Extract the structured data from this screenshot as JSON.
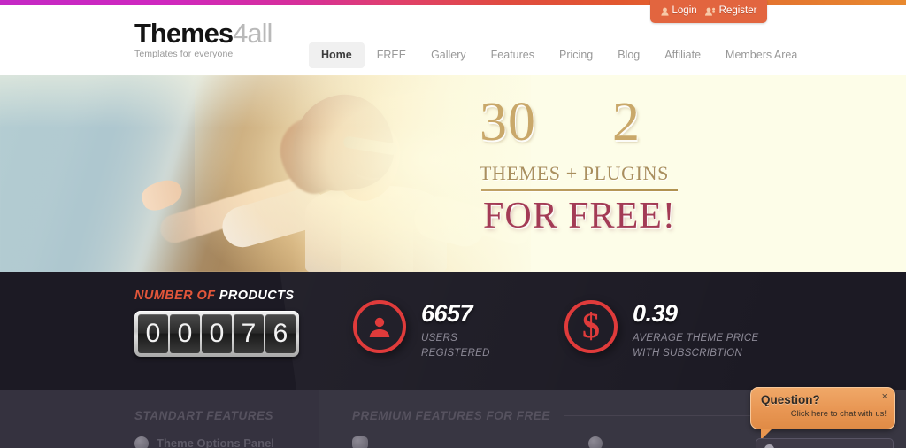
{
  "topbar": {
    "gradient_from": "#c429c4",
    "gradient_to": "#e8892f"
  },
  "auth": {
    "login_label": "Login",
    "register_label": "Register",
    "bg_color": "#e2653f"
  },
  "logo": {
    "part1": "Themes",
    "part2": "4all",
    "tagline": "Templates for everyone"
  },
  "nav": {
    "items": [
      {
        "label": "Home",
        "active": true
      },
      {
        "label": "FREE",
        "active": false
      },
      {
        "label": "Gallery",
        "active": false
      },
      {
        "label": "Features",
        "active": false
      },
      {
        "label": "Pricing",
        "active": false
      },
      {
        "label": "Blog",
        "active": false
      },
      {
        "label": "Affiliate",
        "active": false
      },
      {
        "label": "Members Area",
        "active": false
      }
    ]
  },
  "hero": {
    "themes_count": "30",
    "plugins_count": "2",
    "subtitle": "THEMES + PLUGINS",
    "headline": "FOR FREE!",
    "number_color": "#c9a86a",
    "headline_color": "#a33b55",
    "bg_color": "#fdfde8"
  },
  "stats": {
    "bg_color": "#1c1a24",
    "counter": {
      "label_orange": "NUMBER OF",
      "label_white": "PRODUCTS",
      "digits": [
        "0",
        "0",
        "0",
        "7",
        "6"
      ],
      "value": "00076"
    },
    "blocks": [
      {
        "icon": "user-icon",
        "number": "6657",
        "caption_line1": "USERS",
        "caption_line2": "REGISTERED"
      },
      {
        "icon": "dollar-icon",
        "number": "0.39",
        "caption_line1": "AVERAGE THEME PRICE",
        "caption_line2": "WITH SUBSCRIBTION"
      }
    ],
    "accent_color": "#e03b3b"
  },
  "features": {
    "bg_color": "#35323f",
    "standard": {
      "heading": "STANDART FEATURES",
      "items": [
        "Theme Options Panel"
      ]
    },
    "premium": {
      "heading": "PREMIUM FEATURES FOR FREE",
      "items": [
        "",
        ""
      ]
    }
  },
  "chat": {
    "title": "Question?",
    "subtitle": "Click here to chat with us!",
    "close_label": "×",
    "bg_color": "#e89653"
  }
}
